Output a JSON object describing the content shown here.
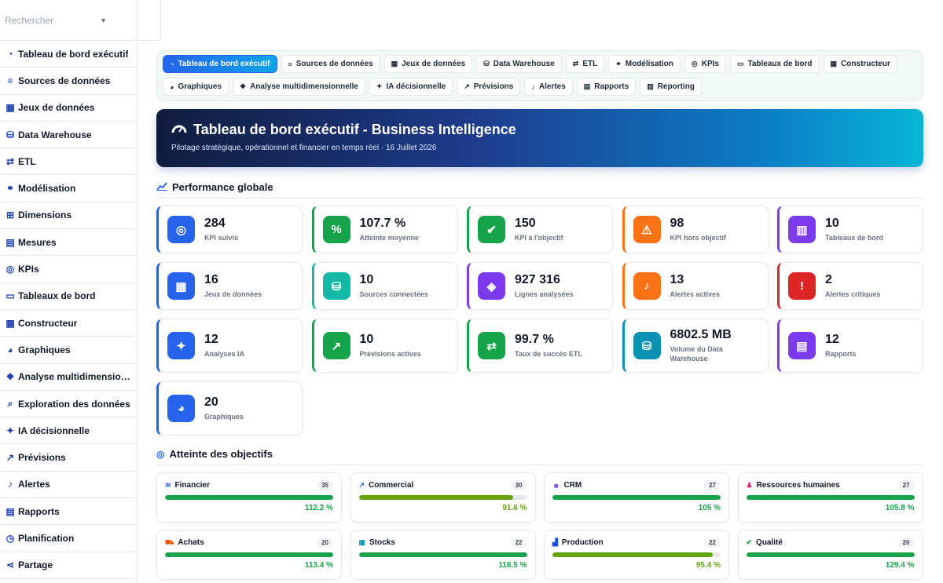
{
  "search": {
    "placeholder": "Rechercher"
  },
  "sidebar": {
    "items": [
      {
        "label": "Tableau de bord exécutif",
        "icon": "gauge-icon"
      },
      {
        "label": "Sources de données",
        "icon": "database-icon"
      },
      {
        "label": "Jeux de données",
        "icon": "table-icon"
      },
      {
        "label": "Data Warehouse",
        "icon": "warehouse-icon"
      },
      {
        "label": "ETL",
        "icon": "exchange-icon"
      },
      {
        "label": "Modélisation",
        "icon": "diagram-icon"
      },
      {
        "label": "Dimensions",
        "icon": "sitemap-icon"
      },
      {
        "label": "Mesures",
        "icon": "calculator-icon"
      },
      {
        "label": "KPIs",
        "icon": "target-icon"
      },
      {
        "label": "Tableaux de bord",
        "icon": "window-icon"
      },
      {
        "label": "Constructeur",
        "icon": "grid-icon"
      },
      {
        "label": "Graphiques",
        "icon": "pie-icon"
      },
      {
        "label": "Analyse multidimensionnelle",
        "icon": "cubes-icon"
      },
      {
        "label": "Exploration des données",
        "icon": "search-icon"
      },
      {
        "label": "IA décisionnelle",
        "icon": "bulb-icon"
      },
      {
        "label": "Prévisions",
        "icon": "chart-line-icon"
      },
      {
        "label": "Alertes",
        "icon": "bell-icon"
      },
      {
        "label": "Rapports",
        "icon": "file-icon"
      },
      {
        "label": "Planification",
        "icon": "clock-icon"
      },
      {
        "label": "Partage",
        "icon": "share-icon"
      }
    ]
  },
  "tabs": [
    {
      "label": "Tableau de bord exécutif",
      "icon": "gauge-icon",
      "glyph": "◔",
      "active": true
    },
    {
      "label": "Sources de données",
      "icon": "database-icon",
      "glyph": "≡"
    },
    {
      "label": "Jeux de données",
      "icon": "table-icon",
      "glyph": "▦"
    },
    {
      "label": "Data Warehouse",
      "icon": "warehouse-icon",
      "glyph": "⛁"
    },
    {
      "label": "ETL",
      "icon": "exchange-icon",
      "glyph": "⇄"
    },
    {
      "label": "Modélisation",
      "icon": "diagram-icon",
      "glyph": "⚭"
    },
    {
      "label": "KPIs",
      "icon": "target-icon",
      "glyph": "◎"
    },
    {
      "label": "Tableaux de bord",
      "icon": "window-icon",
      "glyph": "▭"
    },
    {
      "label": "Constructeur",
      "icon": "grid-icon",
      "glyph": "▦"
    },
    {
      "label": "Graphiques",
      "icon": "pie-icon",
      "glyph": "◕"
    },
    {
      "label": "Analyse multidimensionnelle",
      "icon": "cubes-icon",
      "glyph": "❖"
    },
    {
      "label": "IA décisionnelle",
      "icon": "bulb-icon",
      "glyph": "✦"
    },
    {
      "label": "Prévisions",
      "icon": "chart-line-icon",
      "glyph": "↗"
    },
    {
      "label": "Alertes",
      "icon": "bell-icon",
      "glyph": "♪"
    },
    {
      "label": "Rapports",
      "icon": "file-icon",
      "glyph": "▤"
    },
    {
      "label": "Reporting",
      "icon": "chart-bar-icon",
      "glyph": "▥"
    }
  ],
  "hero": {
    "title": "Tableau de bord exécutif - Business Intelligence",
    "subtitle": "Pilotage stratégique, opérationnel et financier en temps réel · 16 Juillet 2026"
  },
  "performance": {
    "title": "Performance globale",
    "kpis": [
      {
        "value": "284",
        "label": "KPI suivis",
        "color": "#2563eb",
        "icon": "target-icon",
        "glyph": "◎"
      },
      {
        "value": "107.7 %",
        "label": "Atteinte moyenne",
        "color": "#16a34a",
        "icon": "percent-icon",
        "glyph": "%"
      },
      {
        "value": "150",
        "label": "KPI à l'objectif",
        "color": "#16a34a",
        "icon": "check-circle-icon",
        "glyph": "✔"
      },
      {
        "value": "98",
        "label": "KPI hors objectif",
        "color": "#f97316",
        "icon": "warning-icon",
        "glyph": "⚠"
      },
      {
        "value": "10",
        "label": "Tableaux de bord",
        "color": "#7c3aed",
        "icon": "window-icon",
        "glyph": "▥"
      },
      {
        "value": "16",
        "label": "Jeux de données",
        "color": "#2563eb",
        "icon": "table-icon",
        "glyph": "▦"
      },
      {
        "value": "10",
        "label": "Sources connectées",
        "color": "#14b8a6",
        "icon": "database-icon",
        "glyph": "⛁"
      },
      {
        "value": "927 316",
        "label": "Lignes analysées",
        "color": "#7c3aed",
        "icon": "layers-icon",
        "glyph": "◈"
      },
      {
        "value": "13",
        "label": "Alertes actives",
        "color": "#f97316",
        "icon": "bell-icon",
        "glyph": "♪"
      },
      {
        "value": "2",
        "label": "Alertes critiques",
        "color": "#dc2626",
        "icon": "exclamation-circle-icon",
        "glyph": "!"
      },
      {
        "value": "12",
        "label": "Analyses IA",
        "color": "#2563eb",
        "icon": "bulb-icon",
        "glyph": "✦"
      },
      {
        "value": "10",
        "label": "Prévisions actives",
        "color": "#16a34a",
        "icon": "chart-line-icon",
        "glyph": "↗"
      },
      {
        "value": "99.7 %",
        "label": "Taux de succès ETL",
        "color": "#16a34a",
        "icon": "exchange-icon",
        "glyph": "⇄"
      },
      {
        "value": "6802.5 MB",
        "label": "Volume du Data Warehouse",
        "color": "#0891b2",
        "icon": "warehouse-icon",
        "glyph": "⛁"
      },
      {
        "value": "12",
        "label": "Rapports",
        "color": "#7c3aed",
        "icon": "file-icon",
        "glyph": "▤"
      },
      {
        "value": "20",
        "label": "Graphiques",
        "color": "#2563eb",
        "icon": "pie-icon",
        "glyph": "◕"
      }
    ]
  },
  "objectives": {
    "title": "Atteinte des objectifs",
    "items": [
      {
        "name": "Financier",
        "count": "35",
        "pct": "112.2 %",
        "fill": 1.0,
        "color": "#16a34a",
        "icon": "coins-icon",
        "glyph": "≋",
        "icon_color": "#2563eb"
      },
      {
        "name": "Commercial",
        "count": "30",
        "pct": "91.6 %",
        "fill": 0.916,
        "color": "#65a30d",
        "icon": "chart-line-icon",
        "glyph": "↗",
        "icon_color": "#2563eb"
      },
      {
        "name": "CRM",
        "count": "27",
        "pct": "105 %",
        "fill": 1.0,
        "color": "#16a34a",
        "icon": "users-icon",
        "glyph": "☻",
        "icon_color": "#7c3aed"
      },
      {
        "name": "Ressources humaines",
        "count": "27",
        "pct": "105.8 %",
        "fill": 1.0,
        "color": "#16a34a",
        "icon": "user-icon",
        "glyph": "♟",
        "icon_color": "#db2777"
      },
      {
        "name": "Achats",
        "count": "20",
        "pct": "113.4 %",
        "fill": 1.0,
        "color": "#16a34a",
        "icon": "cart-icon",
        "glyph": "⛟",
        "icon_color": "#ea580c"
      },
      {
        "name": "Stocks",
        "count": "22",
        "pct": "116.5 %",
        "fill": 1.0,
        "color": "#16a34a",
        "icon": "boxes-icon",
        "glyph": "▣",
        "icon_color": "#0891b2"
      },
      {
        "name": "Production",
        "count": "22",
        "pct": "95.4 %",
        "fill": 0.954,
        "color": "#65a30d",
        "icon": "industry-icon",
        "glyph": "▟",
        "icon_color": "#1d4ed8"
      },
      {
        "name": "Qualité",
        "count": "20",
        "pct": "129.4 %",
        "fill": 1.0,
        "color": "#16a34a",
        "icon": "check-circle-icon",
        "glyph": "✔",
        "icon_color": "#16a34a"
      }
    ]
  }
}
